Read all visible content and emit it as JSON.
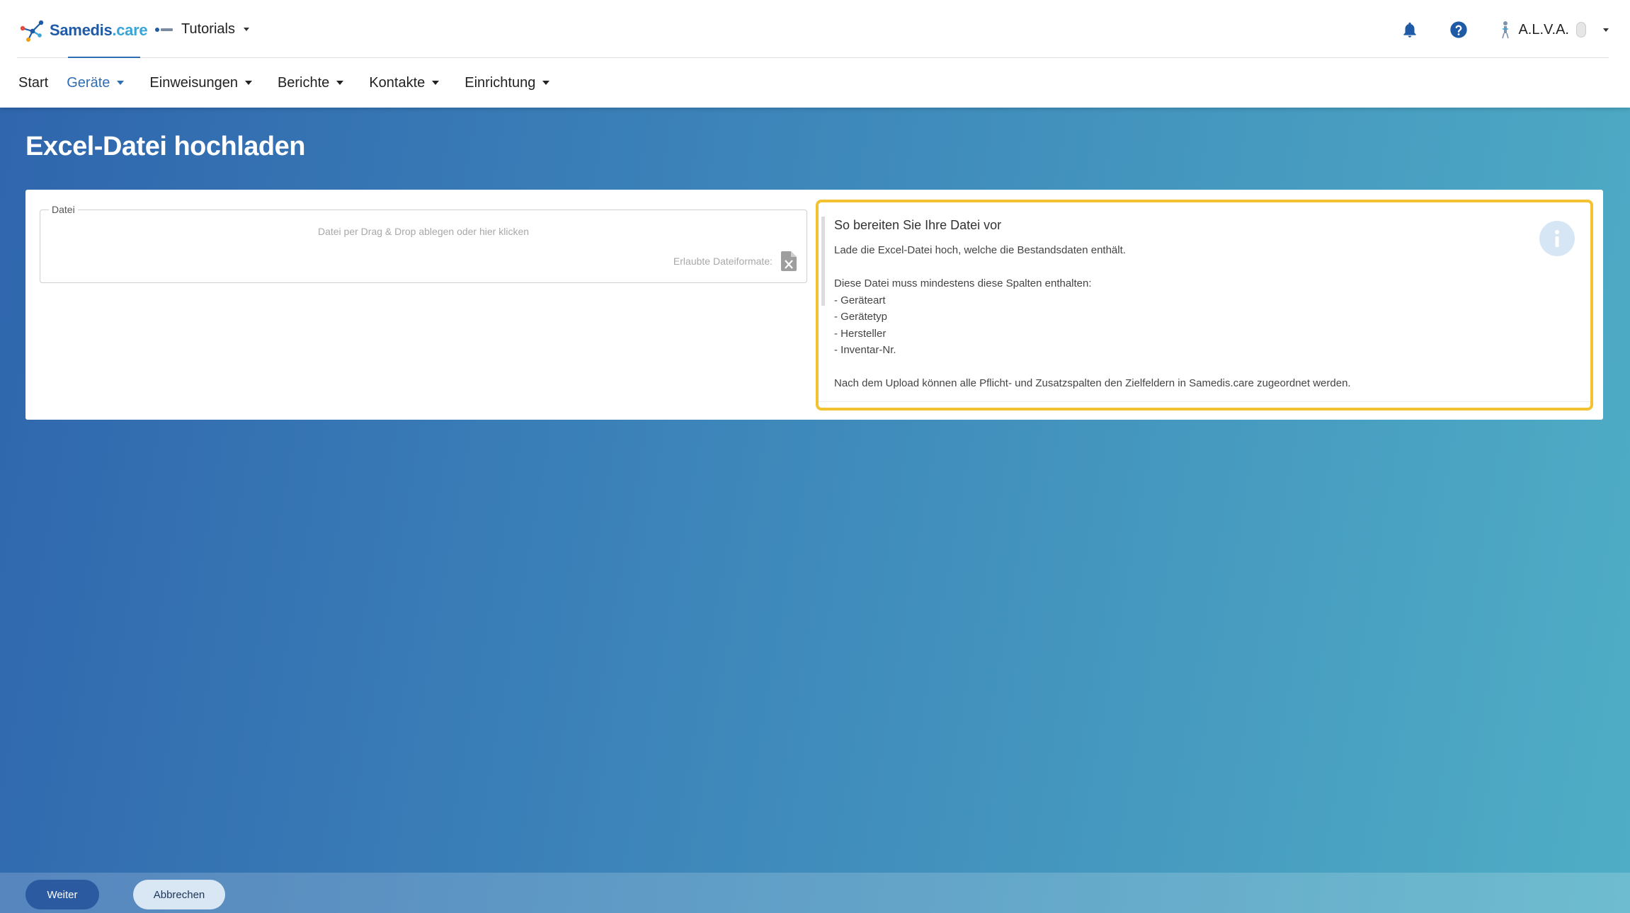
{
  "app": {
    "logo_main": "Samedis",
    "logo_suffix": ".care",
    "tenant_label": "Tutorials",
    "user_label": "A.L.V.A."
  },
  "nav": {
    "items": [
      {
        "label": "Start"
      },
      {
        "label": "Geräte"
      },
      {
        "label": "Einweisungen"
      },
      {
        "label": "Berichte"
      },
      {
        "label": "Kontakte"
      },
      {
        "label": "Einrichtung"
      }
    ],
    "active": "Geräte"
  },
  "page": {
    "title": "Excel-Datei hochladen"
  },
  "upload": {
    "legend": "Datei",
    "hint": "Datei per Drag & Drop ablegen oder hier klicken",
    "formats_label": "Erlaubte Dateiformate:"
  },
  "info": {
    "title": "So bereiten Sie Ihre Datei vor",
    "intro": "Lade die Excel-Datei hoch, welche die Bestandsdaten enthält.",
    "columns_intro": "Diese Datei muss mindestens diese Spalten enthalten:",
    "columns": [
      "- Geräteart",
      "- Gerätetyp",
      "- Hersteller",
      "- Inventar-Nr."
    ],
    "outro": "Nach dem Upload können alle Pflicht- und Zusatzspalten den Zielfeldern in Samedis.care zugeordnet werden."
  },
  "footer": {
    "next_label": "Weiter",
    "cancel_label": "Abbrechen"
  },
  "colors": {
    "brand": "#1f5aa6",
    "accent": "#2f6db3",
    "highlight": "#f2c230"
  }
}
